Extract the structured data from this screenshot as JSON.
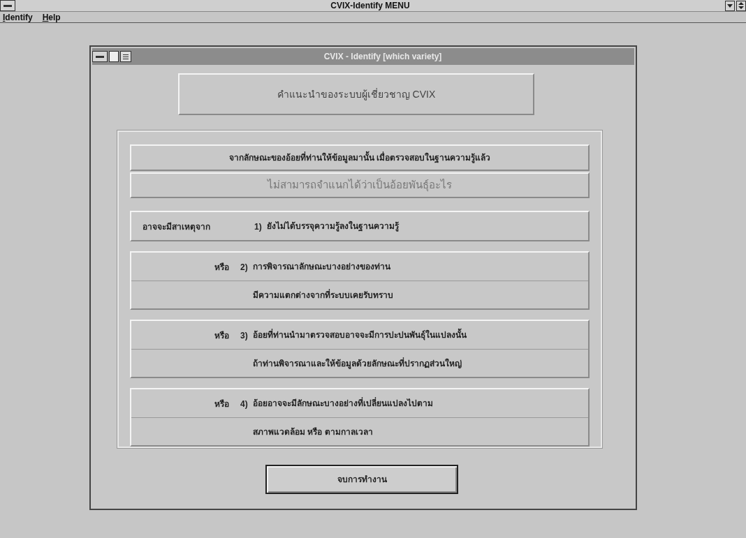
{
  "window": {
    "title": "CVIX-Identify MENU"
  },
  "menu": [
    {
      "label": "Identify"
    },
    {
      "label": "Help"
    }
  ],
  "dialog": {
    "title": "CVIX - Identify  [which variety]",
    "header": "คำแนะนำของระบบผู้เชี่ยวชาญ CVIX",
    "summary": "จากลักษณะของอ้อยที่ท่านให้ข้อมูลมานั้น  เมื่อตรวจสอบในฐานความรู้แล้ว",
    "result": "ไม่สามารถจำแนกได้ว่าเป็นอ้อยพันธุ์อะไร",
    "reasons": [
      {
        "lead": "อาจจะมีสาเหตุจาก",
        "number": "1)",
        "lines": [
          "ยังไม่ได้บรรจุความรู้ลงในฐานความรู้"
        ]
      },
      {
        "lead": "หรือ",
        "number": "2)",
        "lines": [
          "การพิจารณาลักษณะบางอย่างของท่าน",
          "มีความแตกต่างจากที่ระบบเคยรับทราบ"
        ]
      },
      {
        "lead": "หรือ",
        "number": "3)",
        "lines": [
          "อ้อยที่ท่านนำมาตรวจสอบอาจจะมีการปะปนพันธุ์ในแปลงนั้น",
          "ถ้าท่านพิจารณาและให้ข้อมูลด้วยลักษณะที่ปรากฏส่วนใหญ่"
        ]
      },
      {
        "lead": "หรือ",
        "number": "4)",
        "lines": [
          "อ้อยอาจจะมีลักษณะบางอย่างที่เปลี่ยนแปลงไปตาม",
          "สภาพแวดล้อม หรือ ตามกาลเวลา"
        ]
      }
    ],
    "button": "จบการทำงาน"
  }
}
